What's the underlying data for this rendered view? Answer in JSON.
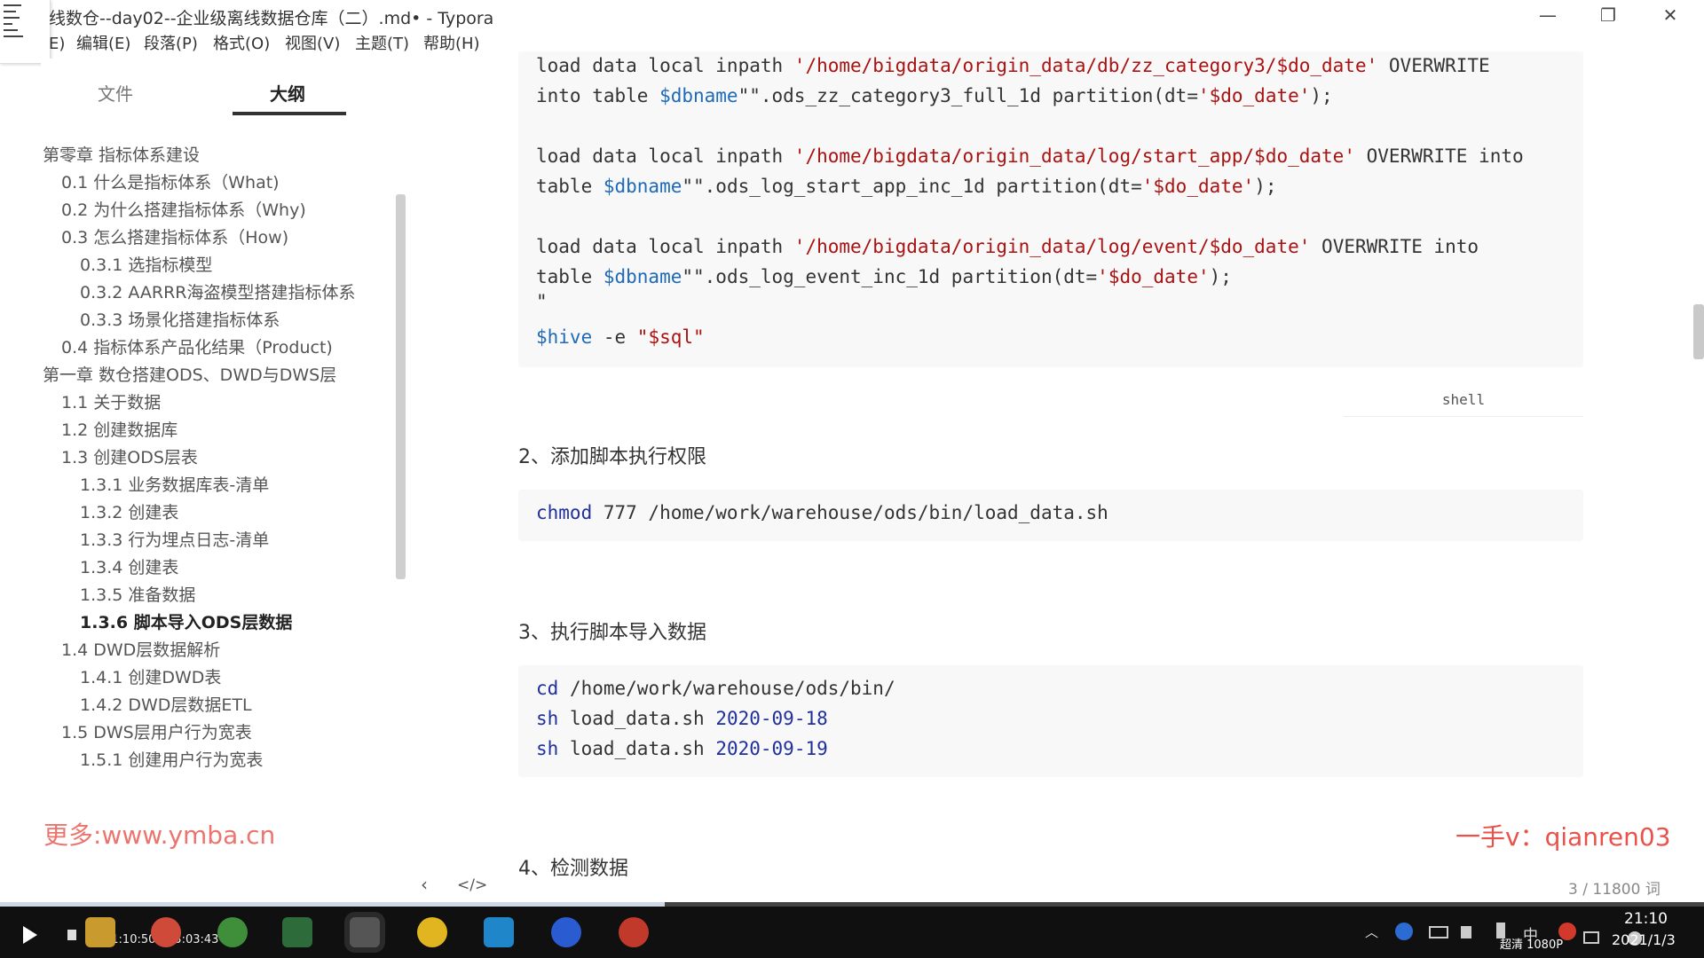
{
  "window": {
    "title": "线数仓--day02--企业级离线数据仓库（二）.md• - Typora",
    "minimize": "—",
    "restore": "❐",
    "close": "✕"
  },
  "menu": [
    "编辑(E)",
    "段落(P)",
    "格式(O)",
    "视图(V)",
    "主题(T)",
    "帮助(H)"
  ],
  "menu_partial": "E)",
  "sidebar": {
    "tabs": [
      "文件",
      "大纲"
    ],
    "active_tab": 1,
    "outline": [
      {
        "label": "第零章 指标体系建设",
        "level": 1
      },
      {
        "label": "0.1 什么是指标体系（What)",
        "level": 2
      },
      {
        "label": "0.2 为什么搭建指标体系（Why)",
        "level": 2
      },
      {
        "label": "0.3 怎么搭建指标体系（How)",
        "level": 2
      },
      {
        "label": "0.3.1 选指标模型",
        "level": 3
      },
      {
        "label": "0.3.2 AARRR海盗模型搭建指标体系",
        "level": 3
      },
      {
        "label": "0.3.3 场景化搭建指标体系",
        "level": 3
      },
      {
        "label": "0.4 指标体系产品化结果（Product)",
        "level": 2
      },
      {
        "label": "第一章 数仓搭建ODS、DWD与DWS层",
        "level": 1
      },
      {
        "label": "1.1 关于数据",
        "level": 2
      },
      {
        "label": "1.2 创建数据库",
        "level": 2
      },
      {
        "label": "1.3 创建ODS层表",
        "level": 2
      },
      {
        "label": "1.3.1 业务数据库表-清单",
        "level": 3
      },
      {
        "label": "1.3.2 创建表",
        "level": 3
      },
      {
        "label": "1.3.3 行为埋点日志-清单",
        "level": 3
      },
      {
        "label": "1.3.4 创建表",
        "level": 3
      },
      {
        "label": "1.3.5 准备数据",
        "level": 3
      },
      {
        "label": "1.3.6 脚本导入ODS层数据",
        "level": 3,
        "active": true
      },
      {
        "label": "1.4 DWD层数据解析",
        "level": 2
      },
      {
        "label": "1.4.1 创建DWD表",
        "level": 3
      },
      {
        "label": "1.4.2 DWD层数据ETL",
        "level": 3
      },
      {
        "label": "1.5 DWS层用户行为宽表",
        "level": 2
      },
      {
        "label": "1.5.1 创建用户行为宽表",
        "level": 3
      }
    ]
  },
  "watermarks": {
    "left": "更多:www.ymba.cn",
    "right": "一手v：qianren03"
  },
  "editor": {
    "code1": {
      "l1a": "load data local inpath ",
      "l1b": "'/home/bigdata/origin_data/db/zz_category3/",
      "l1c": "$do_date",
      "l1d": "'",
      "l1e": " OVERWRITE",
      "l2a": "into table ",
      "l2b": "$dbname",
      "l2c": "\"\".ods_zz_category3_full_1d partition(dt=",
      "l2d": "'$do_date'",
      "l2e": ");",
      "l3a": "load data local inpath ",
      "l3b": "'/home/bigdata/origin_data/log/start_app/",
      "l3c": "$do_date",
      "l3d": "'",
      "l3e": " OVERWRITE into",
      "l4a": "table ",
      "l4b": "$dbname",
      "l4c": "\"\".ods_log_start_app_inc_1d partition(dt=",
      "l4d": "'$do_date'",
      "l4e": ");",
      "l5a": "load data local inpath ",
      "l5b": "'/home/bigdata/origin_data/log/event/",
      "l5c": "$do_date",
      "l5d": "'",
      "l5e": " OVERWRITE into",
      "l6a": "table ",
      "l6b": "$dbname",
      "l6c": "\"\".ods_log_event_inc_1d partition(dt=",
      "l6d": "'$do_date'",
      "l6e": ");",
      "l7": "\"",
      "l8a": "$hive",
      "l8b": " -e ",
      "l8c": "\"$sql\"",
      "lang": "shell"
    },
    "h2": "2、添加脚本执行权限",
    "code2": {
      "a": "chmod",
      "b": " 777 /home/work/warehouse/ods/bin/load_data.sh"
    },
    "h3": "3、执行脚本导入数据",
    "code3": {
      "l1a": "cd",
      "l1b": " /home/work/warehouse/ods/bin/",
      "l2a": "sh",
      "l2b": " load_data.sh ",
      "l2c": "2020-09-18",
      "l3a": "sh",
      "l3b": " load_data.sh ",
      "l3c": "2020-09-19"
    },
    "h4": "4、检测数据",
    "word_count": "3 / 11800 词",
    "nav_back": "‹",
    "nav_source": "</>"
  },
  "player": {
    "time": "01:10:50 / 03:03:43",
    "progress": 0.39,
    "quality": "超清 1080P"
  },
  "system": {
    "ime": "中",
    "clock": "21:10",
    "date": "2021/1/3"
  }
}
